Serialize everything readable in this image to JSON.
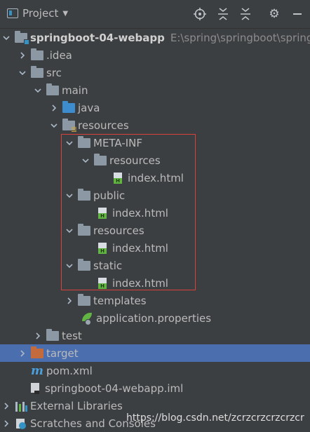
{
  "toolbar": {
    "title": "Project",
    "icons": [
      "project-icon",
      "locate-icon",
      "expand-all-icon",
      "collapse-all-icon",
      "gear-icon",
      "hide-icon"
    ]
  },
  "tree": [
    {
      "label": "springboot-04-webapp",
      "path": "E:\\spring\\springboot\\springb",
      "icon": "module-folder-icon",
      "expanded": true
    },
    {
      "label": ".idea",
      "icon": "folder-icon",
      "expanded": false
    },
    {
      "label": "src",
      "icon": "folder-icon",
      "expanded": true
    },
    {
      "label": "main",
      "icon": "folder-icon",
      "expanded": true
    },
    {
      "label": "java",
      "icon": "source-folder-icon",
      "expanded": false
    },
    {
      "label": "resources",
      "icon": "resources-folder-icon",
      "expanded": true
    },
    {
      "label": "META-INF",
      "icon": "folder-icon",
      "expanded": true
    },
    {
      "label": "resources",
      "icon": "folder-icon",
      "expanded": true
    },
    {
      "label": "index.html",
      "icon": "html-file-icon"
    },
    {
      "label": "public",
      "icon": "folder-icon",
      "expanded": true
    },
    {
      "label": "index.html",
      "icon": "html-file-icon"
    },
    {
      "label": "resources",
      "icon": "folder-icon",
      "expanded": true
    },
    {
      "label": "index.html",
      "icon": "html-file-icon"
    },
    {
      "label": "static",
      "icon": "folder-icon",
      "expanded": true
    },
    {
      "label": "index.html",
      "icon": "html-file-icon"
    },
    {
      "label": "templates",
      "icon": "folder-icon",
      "expanded": false
    },
    {
      "label": "application.properties",
      "icon": "spring-properties-icon"
    },
    {
      "label": "test",
      "icon": "folder-icon",
      "expanded": false
    },
    {
      "label": "target",
      "icon": "excluded-folder-icon",
      "expanded": false,
      "selected": true
    },
    {
      "label": "pom.xml",
      "icon": "maven-icon"
    },
    {
      "label": "springboot-04-webapp.iml",
      "icon": "iml-file-icon"
    },
    {
      "label": "External Libraries",
      "icon": "libraries-icon",
      "expanded": false
    },
    {
      "label": "Scratches and Consoles",
      "icon": "scratches-icon",
      "expanded": false
    }
  ],
  "watermark": "https://blog.csdn.net/zcrzcrzcrzcrzcr",
  "colors": {
    "background": "#3c3f41",
    "selection": "#4b6eaf",
    "highlight_box": "#d9413a"
  }
}
